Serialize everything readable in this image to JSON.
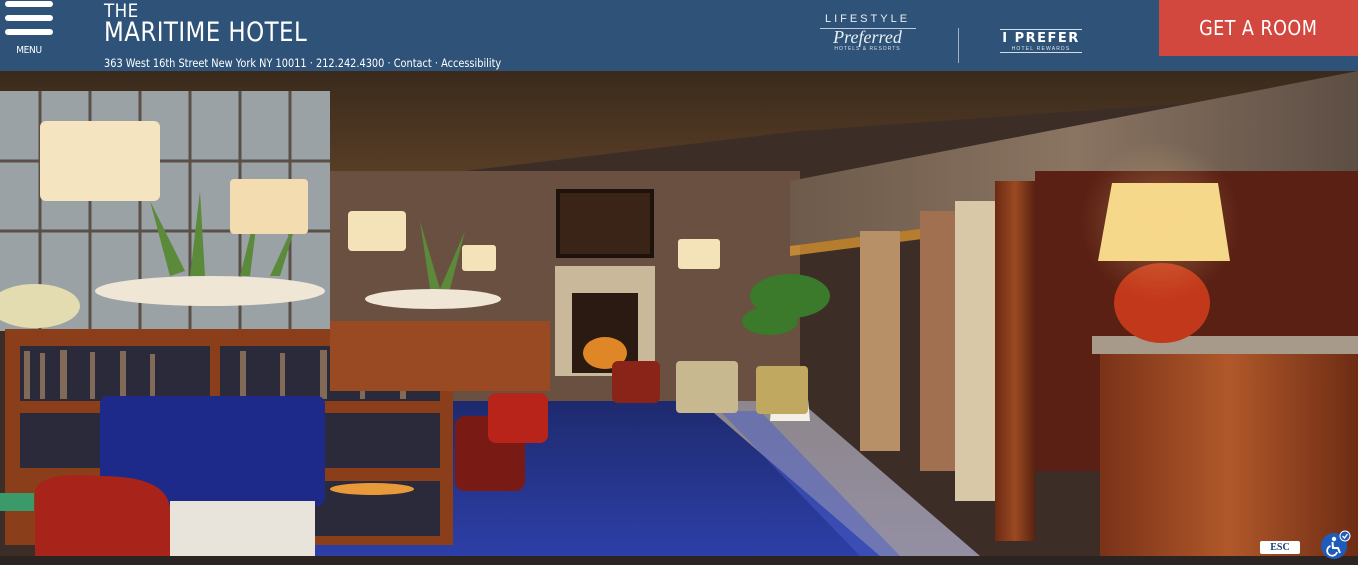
{
  "header": {
    "menu_label": "MENU",
    "brand_the": "THE",
    "brand_name": "MARITIME HOTEL",
    "address": "363 West 16th Street New York NY 10011",
    "phone": "212.242.4300",
    "contact_label": "Contact",
    "accessibility_label": "Accessibility",
    "separator": " · ",
    "cta_label": "GET A ROOM",
    "colors": {
      "bar": "#2f5378",
      "cta": "#d2473e"
    }
  },
  "partners": {
    "lifestyle_top": "LIFESTYLE",
    "lifestyle_script": "Preferred",
    "lifestyle_sub": "HOTELS & RESORTS",
    "iprefer_title": "I PREFER",
    "iprefer_sub": "HOTEL REWARDS"
  },
  "hero": {
    "icon": "hotel-lobby-photo"
  },
  "accessibility_widget": {
    "esc_label": "ESC",
    "icon": "wheelchair-icon"
  }
}
